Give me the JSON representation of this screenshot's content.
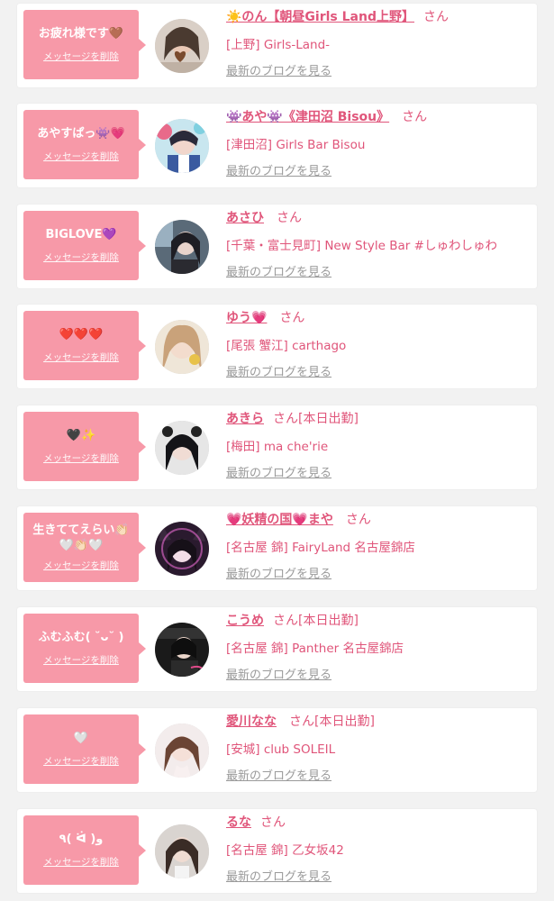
{
  "common": {
    "delete_label": "メッセージを削除",
    "san": "さん",
    "blog_label": "最新のブログを見る"
  },
  "colors": {
    "accent": "#e0557a",
    "bubble": "#f799a8",
    "link_gray": "#9a9a9a"
  },
  "entries": [
    {
      "message": "お疲れ様です🤎",
      "name": "☀️のん【朝昼Girls Land上野】",
      "status": "",
      "shop": "[上野] Girls-Land-"
    },
    {
      "message": "あやすぱっ👾💗",
      "name": "👾あや👾《津田沼 Bisou》",
      "status": "",
      "shop": "[津田沼] Girls Bar Bisou"
    },
    {
      "message": "BIGLOVE💜",
      "name": "あさひ",
      "status": "",
      "shop": "[千葉・富士見町] New Style Bar #しゅわしゅわ"
    },
    {
      "message": "❤️❤️❤️",
      "name": "ゆう💗",
      "status": "",
      "shop": "[尾張 蟹江] carthago"
    },
    {
      "message": "🖤✨",
      "name": "あきら",
      "status": "[本日出勤]",
      "shop": "[梅田] ma che'rie"
    },
    {
      "message": "生きててえらい👏🏻🤍👏🏻🤍",
      "name": "💗妖精の国💗まや",
      "status": "",
      "shop": "[名古屋 錦] FairyLand 名古屋錦店"
    },
    {
      "message": "ふむふむ( ˘ᴗ˘ )",
      "name": "こうめ",
      "status": "[本日出勤]",
      "shop": "[名古屋 錦] Panther 名古屋錦店"
    },
    {
      "message": "🤍",
      "name": "愛川なな",
      "status": "[本日出勤]",
      "shop": "[安城] club SOLEIL"
    },
    {
      "message": "٩( ᐛ )و",
      "name": "るな",
      "status": "",
      "shop": "[名古屋 錦] 乙女坂42"
    }
  ]
}
